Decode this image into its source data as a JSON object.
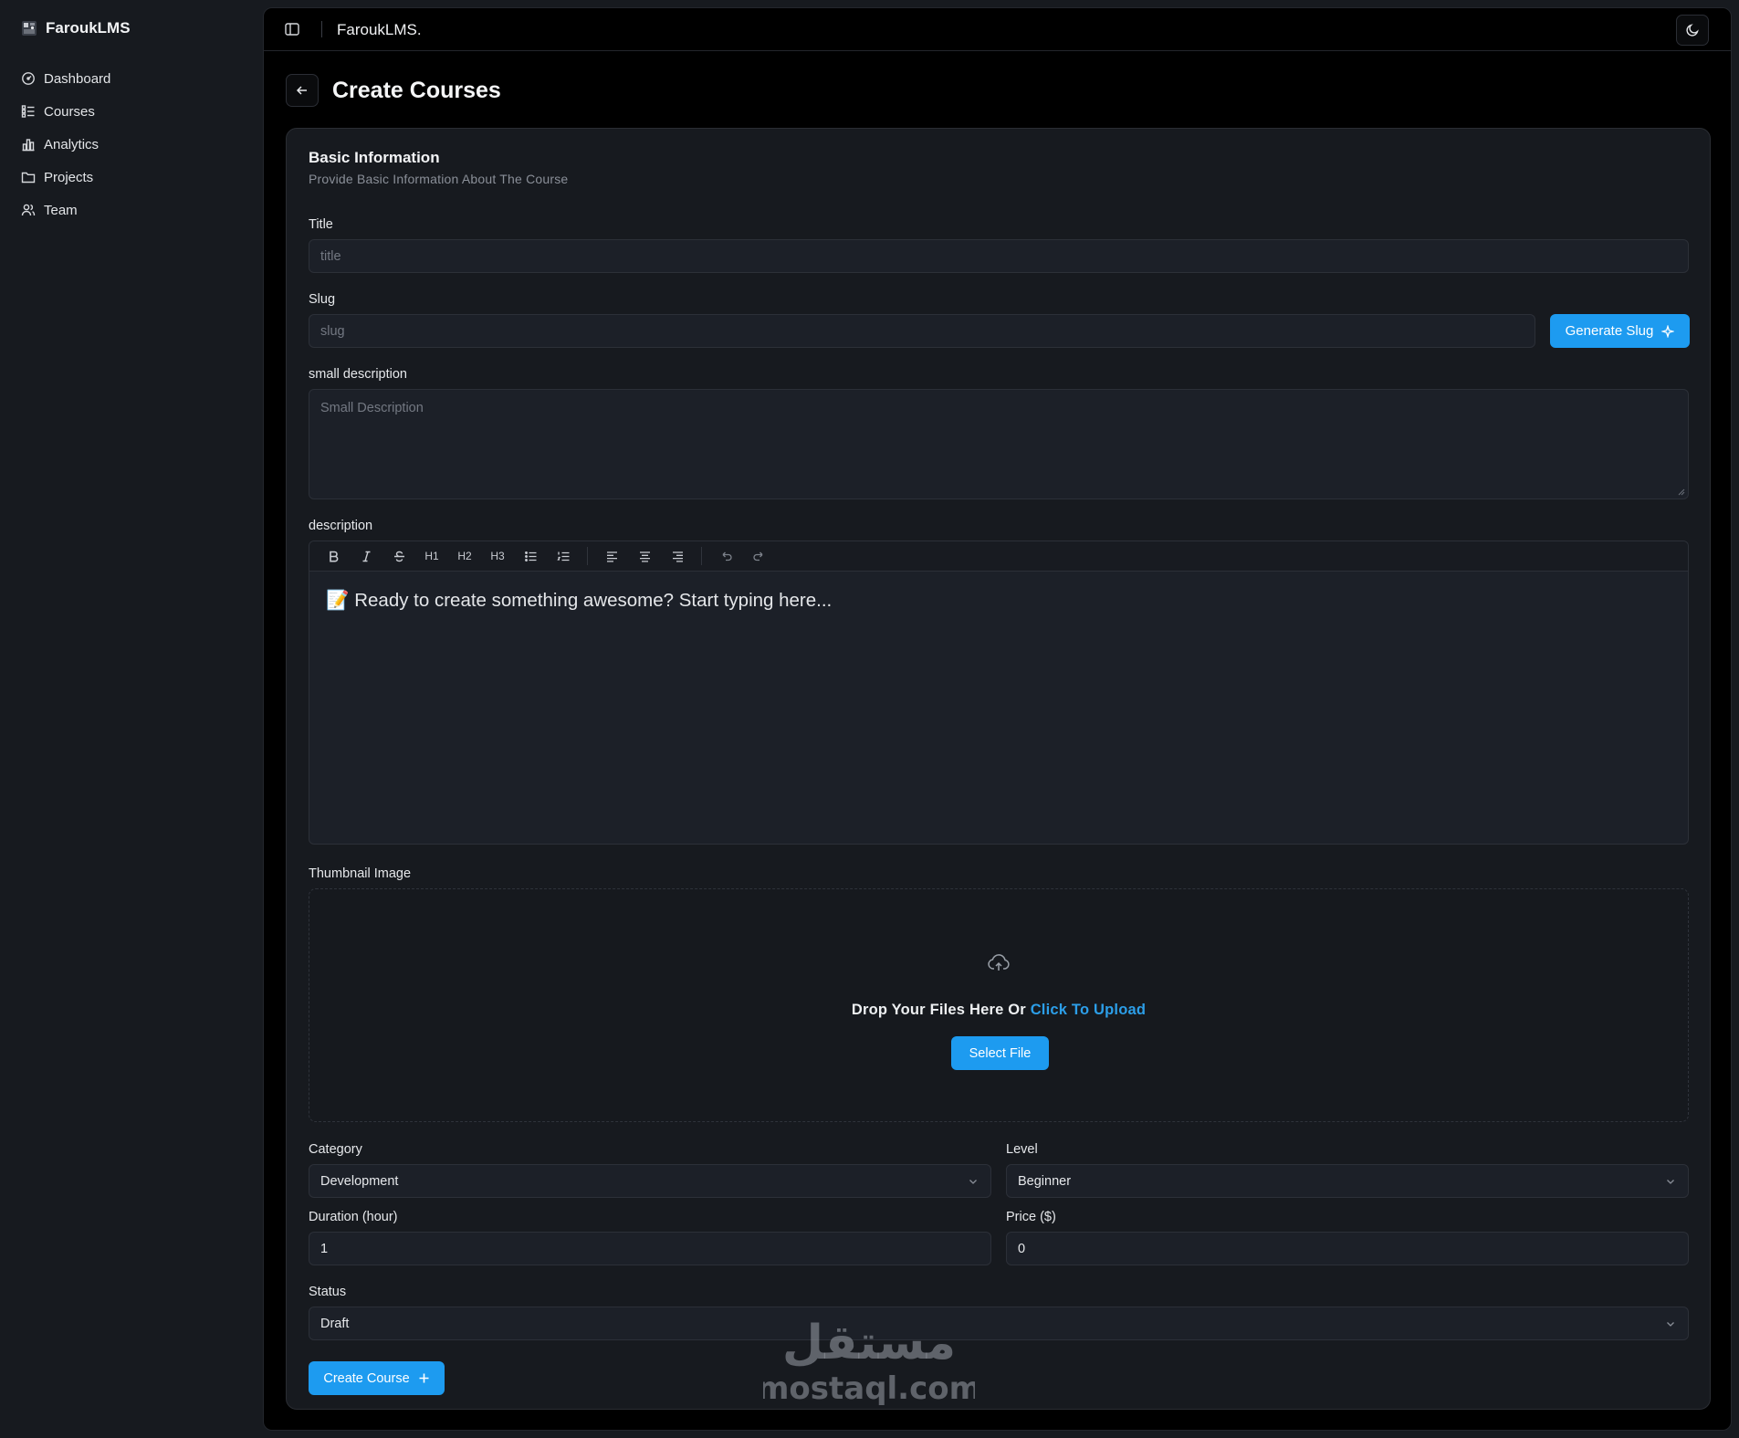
{
  "sidebar": {
    "brand": "FaroukLMS",
    "items": [
      {
        "label": "Dashboard",
        "icon": "gauge-icon"
      },
      {
        "label": "Courses",
        "icon": "list-icon"
      },
      {
        "label": "Analytics",
        "icon": "bar-chart-icon"
      },
      {
        "label": "Projects",
        "icon": "folder-icon"
      },
      {
        "label": "Team",
        "icon": "users-icon"
      }
    ]
  },
  "header": {
    "title": "FaroukLMS."
  },
  "page": {
    "title": "Create Courses"
  },
  "form": {
    "section_title": "Basic Information",
    "section_subtitle": "Provide Basic Information About The Course",
    "title_label": "Title",
    "title_placeholder": "title",
    "slug_label": "Slug",
    "slug_placeholder": "slug",
    "generate_slug_label": "Generate Slug",
    "small_description_label": "small description",
    "small_description_placeholder": "Small Description",
    "description_label": "description",
    "editor_placeholder": "📝 Ready to create something awesome? Start typing here...",
    "thumbnail_label": "Thumbnail Image",
    "drop_text": "Drop Your Files Here Or",
    "drop_link": "Click To Upload",
    "select_file_label": "Select File",
    "category_label": "Category",
    "category_value": "Development",
    "level_label": "Level",
    "level_value": "Beginner",
    "duration_label": "Duration (hour)",
    "duration_value": "1",
    "price_label": "Price ($)",
    "price_value": "0",
    "status_label": "Status",
    "status_value": "Draft",
    "submit_label": "Create Course"
  },
  "toolbar": {
    "h1": "H1",
    "h2": "H2",
    "h3": "H3"
  },
  "watermark": {
    "arabic": "مستقل",
    "latin": "mostaql.com"
  },
  "colors": {
    "accent": "#1d9bf0",
    "link": "#2c9ee8",
    "panel": "#171a1f",
    "input_bg": "#1c2028"
  }
}
